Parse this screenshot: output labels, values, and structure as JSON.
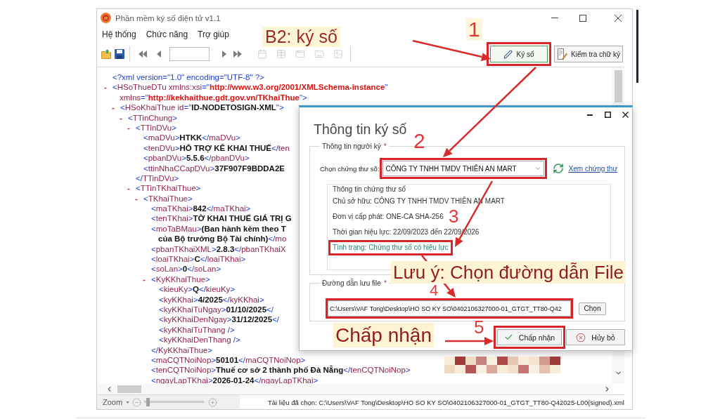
{
  "window": {
    "title": "Phần mềm ký số điện tử v1.1"
  },
  "menu": [
    "Hệ thống",
    "Chức năng",
    "Trợ giúp"
  ],
  "annotations": {
    "heading": "B2: ký số",
    "steps": [
      "1",
      "2",
      "3",
      "4",
      "5"
    ],
    "notes": [
      "Lưu ý: Chọn đường dẫn File",
      "Chấp nhận"
    ]
  },
  "toolbar": {
    "icon_buttons": [
      {
        "disabled": false
      },
      {
        "disabled": false
      },
      {
        "disabled": false
      },
      {
        "disabled": false
      },
      {
        "disabled": false
      },
      {
        "disabled": false
      },
      {
        "disabled": true
      },
      {
        "disabled": true
      },
      {
        "disabled": true
      },
      {
        "disabled": true
      },
      {
        "disabled": true
      }
    ],
    "actions": [
      {
        "label": "Ký số",
        "focused": true,
        "highlighted": true
      },
      {
        "label": "Kiểm tra chữ ký",
        "focused": false,
        "highlighted": false
      }
    ]
  },
  "xml_view": {
    "nodes": [
      {
        "kind": "leaf",
        "lines": [
          [
            {
              "kind": "mark",
              "text": "<?xml version=\"1.0\" encoding=\"UTF-8\" ?>"
            }
          ]
        ]
      },
      {
        "kind": "element",
        "toggle": "-",
        "open": [
          [
            {
              "kind": "mark",
              "text": "<"
            },
            {
              "kind": "name",
              "text": "HSoThueDTu xmlns:xsi"
            },
            {
              "kind": "mark",
              "text": "=\""
            },
            {
              "kind": "link",
              "text": "http://www.w3.org/2001/XMLSchema-instance"
            },
            {
              "kind": "mark",
              "text": "\""
            }
          ],
          [
            {
              "kind": "name",
              "text": "xmlns"
            },
            {
              "kind": "mark",
              "text": "=\""
            },
            {
              "kind": "link",
              "text": "http://kekhaithue.gdt.gov.vn/TKhaiThue"
            },
            {
              "kind": "mark",
              "text": "\">"
            }
          ]
        ],
        "children": [
          {
            "kind": "element",
            "toggle": "-",
            "open": [
              [
                {
                  "kind": "mark",
                  "text": "<"
                },
                {
                  "kind": "name",
                  "text": "HSoKhaiThue id"
                },
                {
                  "kind": "mark",
                  "text": "=\""
                },
                {
                  "kind": "value",
                  "text": "ID-NODETOSIGN-XML"
                },
                {
                  "kind": "mark",
                  "text": "\">"
                }
              ]
            ],
            "children": [
              {
                "kind": "element",
                "toggle": "-",
                "open": [
                  [
                    {
                      "kind": "mark",
                      "text": "<"
                    },
                    {
                      "kind": "name",
                      "text": "TTinChung"
                    },
                    {
                      "kind": "mark",
                      "text": ">"
                    }
                  ]
                ],
                "children": [
                  {
                    "kind": "element",
                    "toggle": "-",
                    "open": [
                      [
                        {
                          "kind": "mark",
                          "text": "<"
                        },
                        {
                          "kind": "name",
                          "text": "TTinDVu"
                        },
                        {
                          "kind": "mark",
                          "text": ">"
                        }
                      ]
                    ],
                    "children": [
                      {
                        "kind": "leaf",
                        "lines": [
                          [
                            {
                              "kind": "mark",
                              "text": "<"
                            },
                            {
                              "kind": "name",
                              "text": "maDVu"
                            },
                            {
                              "kind": "mark",
                              "text": ">"
                            },
                            {
                              "kind": "value",
                              "text": "HTKK"
                            },
                            {
                              "kind": "mark",
                              "text": "</"
                            },
                            {
                              "kind": "name",
                              "text": "maDVu"
                            },
                            {
                              "kind": "mark",
                              "text": ">"
                            }
                          ]
                        ]
                      },
                      {
                        "kind": "leaf",
                        "lines": [
                          [
                            {
                              "kind": "mark",
                              "text": "<"
                            },
                            {
                              "kind": "name",
                              "text": "tenDVu"
                            },
                            {
                              "kind": "mark",
                              "text": ">"
                            },
                            {
                              "kind": "value",
                              "text": "HỖ TRỢ KÊ KHAI THUẾ"
                            },
                            {
                              "kind": "mark",
                              "text": "</"
                            },
                            {
                              "kind": "name",
                              "text": "ten"
                            }
                          ]
                        ]
                      },
                      {
                        "kind": "leaf",
                        "lines": [
                          [
                            {
                              "kind": "mark",
                              "text": "<"
                            },
                            {
                              "kind": "name",
                              "text": "pbanDVu"
                            },
                            {
                              "kind": "mark",
                              "text": ">"
                            },
                            {
                              "kind": "value",
                              "text": "5.5.6"
                            },
                            {
                              "kind": "mark",
                              "text": "</"
                            },
                            {
                              "kind": "name",
                              "text": "pbanDVu"
                            },
                            {
                              "kind": "mark",
                              "text": ">"
                            }
                          ]
                        ]
                      },
                      {
                        "kind": "leaf",
                        "lines": [
                          [
                            {
                              "kind": "mark",
                              "text": "<"
                            },
                            {
                              "kind": "name",
                              "text": "ttinNhaCCapDVu"
                            },
                            {
                              "kind": "mark",
                              "text": ">"
                            },
                            {
                              "kind": "value",
                              "text": "37F907F9BDDA2E"
                            }
                          ]
                        ]
                      }
                    ],
                    "close": [
                      {
                        "kind": "mark",
                        "text": "</"
                      },
                      {
                        "kind": "name",
                        "text": "TTinDVu"
                      },
                      {
                        "kind": "mark",
                        "text": ">"
                      }
                    ]
                  },
                  {
                    "kind": "element",
                    "toggle": "-",
                    "open": [
                      [
                        {
                          "kind": "mark",
                          "text": "<"
                        },
                        {
                          "kind": "name",
                          "text": "TTinTKhaiThue"
                        },
                        {
                          "kind": "mark",
                          "text": ">"
                        }
                      ]
                    ],
                    "children": [
                      {
                        "kind": "element",
                        "toggle": "-",
                        "open": [
                          [
                            {
                              "kind": "mark",
                              "text": "<"
                            },
                            {
                              "kind": "name",
                              "text": "TKhaiThue"
                            },
                            {
                              "kind": "mark",
                              "text": ">"
                            }
                          ]
                        ],
                        "children": [
                          {
                            "kind": "leaf",
                            "lines": [
                              [
                                {
                                  "kind": "mark",
                                  "text": "<"
                                },
                                {
                                  "kind": "name",
                                  "text": "maTKhai"
                                },
                                {
                                  "kind": "mark",
                                  "text": ">"
                                },
                                {
                                  "kind": "value",
                                  "text": "842"
                                },
                                {
                                  "kind": "mark",
                                  "text": "</"
                                },
                                {
                                  "kind": "name",
                                  "text": "maTKhai"
                                },
                                {
                                  "kind": "mark",
                                  "text": ">"
                                }
                              ]
                            ]
                          },
                          {
                            "kind": "leaf",
                            "lines": [
                              [
                                {
                                  "kind": "mark",
                                  "text": "<"
                                },
                                {
                                  "kind": "name",
                                  "text": "tenTKhai"
                                },
                                {
                                  "kind": "mark",
                                  "text": ">"
                                },
                                {
                                  "kind": "value",
                                  "text": "TỜ KHAI THUẾ GIÁ TRỊ G"
                                }
                              ]
                            ]
                          },
                          {
                            "kind": "leaf",
                            "lines": [
                              [
                                {
                                  "kind": "mark",
                                  "text": "<"
                                },
                                {
                                  "kind": "name",
                                  "text": "moTaBMau"
                                },
                                {
                                  "kind": "mark",
                                  "text": ">"
                                },
                                {
                                  "kind": "value",
                                  "text": "(Ban hành kèm theo T"
                                }
                              ],
                              [
                                {
                                  "kind": "value",
                                  "text": "của Bộ trưởng Bộ Tài chính)"
                                },
                                {
                                  "kind": "mark",
                                  "text": "</"
                                },
                                {
                                  "kind": "name",
                                  "text": "mo"
                                }
                              ]
                            ]
                          },
                          {
                            "kind": "leaf",
                            "lines": [
                              [
                                {
                                  "kind": "mark",
                                  "text": "<"
                                },
                                {
                                  "kind": "name",
                                  "text": "pbanTKhaiXML"
                                },
                                {
                                  "kind": "mark",
                                  "text": ">"
                                },
                                {
                                  "kind": "value",
                                  "text": "2.8.3"
                                },
                                {
                                  "kind": "mark",
                                  "text": "</"
                                },
                                {
                                  "kind": "name",
                                  "text": "pbanTKhaiX"
                                }
                              ]
                            ]
                          },
                          {
                            "kind": "leaf",
                            "lines": [
                              [
                                {
                                  "kind": "mark",
                                  "text": "<"
                                },
                                {
                                  "kind": "name",
                                  "text": "loaiTKhai"
                                },
                                {
                                  "kind": "mark",
                                  "text": ">"
                                },
                                {
                                  "kind": "value",
                                  "text": "C"
                                },
                                {
                                  "kind": "mark",
                                  "text": "</"
                                },
                                {
                                  "kind": "name",
                                  "text": "loaiTKhai"
                                },
                                {
                                  "kind": "mark",
                                  "text": ">"
                                }
                              ]
                            ]
                          },
                          {
                            "kind": "leaf",
                            "lines": [
                              [
                                {
                                  "kind": "mark",
                                  "text": "<"
                                },
                                {
                                  "kind": "name",
                                  "text": "soLan"
                                },
                                {
                                  "kind": "mark",
                                  "text": ">"
                                },
                                {
                                  "kind": "value",
                                  "text": "0"
                                },
                                {
                                  "kind": "mark",
                                  "text": "</"
                                },
                                {
                                  "kind": "name",
                                  "text": "soLan"
                                },
                                {
                                  "kind": "mark",
                                  "text": ">"
                                }
                              ]
                            ]
                          },
                          {
                            "kind": "element",
                            "toggle": "-",
                            "open": [
                              [
                                {
                                  "kind": "mark",
                                  "text": "<"
                                },
                                {
                                  "kind": "name",
                                  "text": "KyKKhaiThue"
                                },
                                {
                                  "kind": "mark",
                                  "text": ">"
                                }
                              ]
                            ],
                            "children": [
                              {
                                "kind": "leaf",
                                "lines": [
                                  [
                                    {
                                      "kind": "mark",
                                      "text": "<"
                                    },
                                    {
                                      "kind": "name",
                                      "text": "kieuKy"
                                    },
                                    {
                                      "kind": "mark",
                                      "text": ">"
                                    },
                                    {
                                      "kind": "value",
                                      "text": "Q"
                                    },
                                    {
                                      "kind": "mark",
                                      "text": "</"
                                    },
                                    {
                                      "kind": "name",
                                      "text": "kieuKy"
                                    },
                                    {
                                      "kind": "mark",
                                      "text": ">"
                                    }
                                  ]
                                ]
                              },
                              {
                                "kind": "leaf",
                                "lines": [
                                  [
                                    {
                                      "kind": "mark",
                                      "text": "<"
                                    },
                                    {
                                      "kind": "name",
                                      "text": "kyKKhai"
                                    },
                                    {
                                      "kind": "mark",
                                      "text": ">"
                                    },
                                    {
                                      "kind": "value",
                                      "text": "4/2025"
                                    },
                                    {
                                      "kind": "mark",
                                      "text": "</"
                                    },
                                    {
                                      "kind": "name",
                                      "text": "kyKKhai"
                                    },
                                    {
                                      "kind": "mark",
                                      "text": ">"
                                    }
                                  ]
                                ]
                              },
                              {
                                "kind": "leaf",
                                "lines": [
                                  [
                                    {
                                      "kind": "mark",
                                      "text": "<"
                                    },
                                    {
                                      "kind": "name",
                                      "text": "kyKKhaiTuNgay"
                                    },
                                    {
                                      "kind": "mark",
                                      "text": ">"
                                    },
                                    {
                                      "kind": "value",
                                      "text": "01/10/2025"
                                    },
                                    {
                                      "kind": "mark",
                                      "text": "</"
                                    }
                                  ]
                                ]
                              },
                              {
                                "kind": "leaf",
                                "lines": [
                                  [
                                    {
                                      "kind": "mark",
                                      "text": "<"
                                    },
                                    {
                                      "kind": "name",
                                      "text": "kyKKhaiDenNgay"
                                    },
                                    {
                                      "kind": "mark",
                                      "text": ">"
                                    },
                                    {
                                      "kind": "value",
                                      "text": "31/12/2025"
                                    },
                                    {
                                      "kind": "mark",
                                      "text": "</"
                                    }
                                  ]
                                ]
                              },
                              {
                                "kind": "leaf",
                                "lines": [
                                  [
                                    {
                                      "kind": "mark",
                                      "text": "<"
                                    },
                                    {
                                      "kind": "name",
                                      "text": "kyKKhaiTuThang"
                                    },
                                    {
                                      "kind": "mark",
                                      "text": " />"
                                    }
                                  ]
                                ]
                              },
                              {
                                "kind": "leaf",
                                "lines": [
                                  [
                                    {
                                      "kind": "mark",
                                      "text": "<"
                                    },
                                    {
                                      "kind": "name",
                                      "text": "kyKKhaiDenThang"
                                    },
                                    {
                                      "kind": "mark",
                                      "text": " />"
                                    }
                                  ]
                                ]
                              }
                            ],
                            "close": [
                              {
                                "kind": "mark",
                                "text": "</"
                              },
                              {
                                "kind": "name",
                                "text": "KyKKhaiThue"
                              },
                              {
                                "kind": "mark",
                                "text": ">"
                              }
                            ]
                          },
                          {
                            "kind": "leaf",
                            "lines": [
                              [
                                {
                                  "kind": "mark",
                                  "text": "<"
                                },
                                {
                                  "kind": "name",
                                  "text": "maCQTNoiNop"
                                },
                                {
                                  "kind": "mark",
                                  "text": ">"
                                },
                                {
                                  "kind": "value",
                                  "text": "50101"
                                },
                                {
                                  "kind": "mark",
                                  "text": "</"
                                },
                                {
                                  "kind": "name",
                                  "text": "maCQTNoiNop"
                                },
                                {
                                  "kind": "mark",
                                  "text": ">"
                                }
                              ]
                            ]
                          },
                          {
                            "kind": "leaf",
                            "lines": [
                              [
                                {
                                  "kind": "mark",
                                  "text": "<"
                                },
                                {
                                  "kind": "name",
                                  "text": "tenCQTNoiNop"
                                },
                                {
                                  "kind": "mark",
                                  "text": ">"
                                },
                                {
                                  "kind": "value",
                                  "text": "Thuế cơ sở 2 thành phố Đà Nẵng"
                                },
                                {
                                  "kind": "mark",
                                  "text": "</"
                                },
                                {
                                  "kind": "name",
                                  "text": "tenCQTNoiNop"
                                },
                                {
                                  "kind": "mark",
                                  "text": ">"
                                }
                              ]
                            ]
                          },
                          {
                            "kind": "leaf",
                            "lines": [
                              [
                                {
                                  "kind": "mark",
                                  "text": "<"
                                },
                                {
                                  "kind": "name",
                                  "text": "ngayLapTKhai"
                                },
                                {
                                  "kind": "mark",
                                  "text": ">"
                                },
                                {
                                  "kind": "value",
                                  "text": "2026-01-24"
                                },
                                {
                                  "kind": "mark",
                                  "text": "</"
                                },
                                {
                                  "kind": "name",
                                  "text": "ngayLapTKhai"
                                },
                                {
                                  "kind": "mark",
                                  "text": ">"
                                }
                              ]
                            ]
                          }
                        ]
                      }
                    ]
                  }
                ]
              }
            ]
          }
        ]
      }
    ]
  },
  "status_bar": {
    "zoom": {
      "label": "Zoom",
      "level": 0.03
    },
    "document": "Tài liệu đã chọn: C:\\Users\\VAF Tong\\Desktop\\HO SO KY SO\\0402106327000-01_GTGT_TT80-Q42025-L00(signed).xml"
  },
  "dialog": {
    "title": "Thông tin ký số",
    "signer": {
      "legend": "Thông tin người ký",
      "required": "*",
      "certificate": {
        "label": "Chọn chứng thư số:",
        "value": "CÔNG TY TNHH TMDV THIÊN AN MART",
        "highlighted": true
      },
      "view_link": "Xem chứng thư",
      "details": {
        "title": "Thông tin chứng thư số",
        "lines": [
          {
            "kind": "plain",
            "text": "Chủ sở hữu: CÔNG TY TNHH TMDV THIÊN AN MART",
            "highlighted": false
          },
          {
            "kind": "plain",
            "text": "Đơn vị cấp phát: ONE-CA SHA-256",
            "highlighted": false
          },
          {
            "kind": "plain",
            "text": "Thời gian hiệu lực: 22/09/2023 đến 22/09/2026",
            "highlighted": false
          },
          {
            "kind": "status",
            "text": "Tình trạng: Chứng thư số có hiệu lực",
            "highlighted": true
          }
        ]
      }
    },
    "file": {
      "legend": "Đường dẫn lưu file",
      "required": "*",
      "path": "C:\\Users\\VAF Tong\\Desktop\\HO SO KY SO\\0402106327000-01_GTGT_TT80-Q42",
      "highlighted": true,
      "browse": "Chọn"
    },
    "buttons": [
      {
        "kind": "accept",
        "label": "Chấp nhận",
        "highlighted": true
      },
      {
        "kind": "cancel",
        "label": "Hủy bỏ",
        "highlighted": false
      }
    ]
  }
}
